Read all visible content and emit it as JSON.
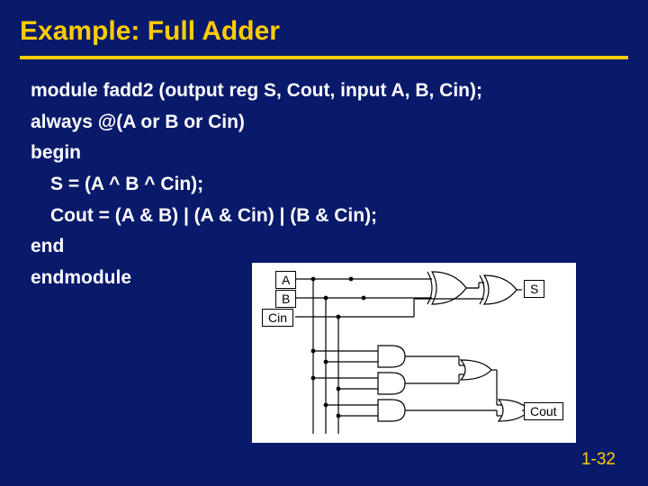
{
  "title": "Example: Full Adder",
  "code": {
    "l1": "module fadd2 (output reg S, Cout, input A, B, Cin);",
    "l2": "always @(A or B or Cin)",
    "l3": "begin",
    "l4": "S = (A ^ B ^ Cin);",
    "l5": "Cout = (A & B) | (A & Cin) | (B & Cin);",
    "l6": "end",
    "l7": "endmodule"
  },
  "diagram": {
    "in1": "A",
    "in2": "B",
    "in3": "Cin",
    "out1": "S",
    "out2": "Cout"
  },
  "pagenum": "1-32"
}
